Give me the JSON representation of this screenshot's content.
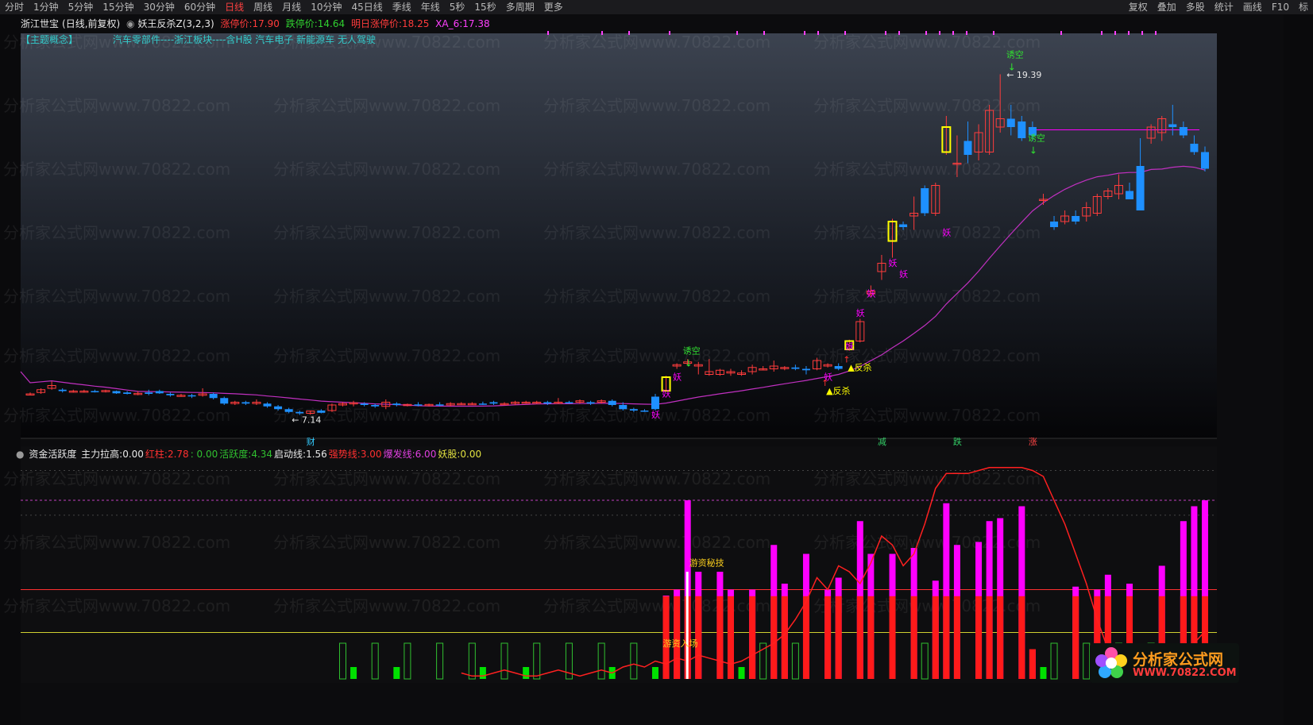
{
  "menu": {
    "items": [
      "分时",
      "1分钟",
      "5分钟",
      "15分钟",
      "30分钟",
      "60分钟",
      "日线",
      "周线",
      "月线",
      "10分钟",
      "45日线",
      "季线",
      "年线",
      "5秒",
      "15秒",
      "多周期",
      "更多"
    ],
    "active": "日线",
    "right_items": [
      "复权",
      "叠加",
      "多股",
      "统计",
      "画线",
      "F10",
      "标"
    ]
  },
  "stock": {
    "name": "浙江世宝",
    "mode": "(日线,前复权)",
    "indicator": "妖王反杀Z(3,2,3)",
    "limit_up_label": "涨停价:",
    "limit_up": "17.90",
    "limit_down_label": "跌停价:",
    "limit_down": "14.64",
    "next_up_label": "明日涨停价:",
    "next_up": "18.25",
    "xa_label": "XA_6:",
    "xa": "17.38"
  },
  "concepts": {
    "label": "【主题概念】",
    "text": "汽车零部件----浙江板块----含H股 汽车电子 新能源车 无人驾驶"
  },
  "watermark": "分析家公式网www.70822.com",
  "annotations": {
    "high": "19.39",
    "low": "7.14",
    "lure_short": "诱空",
    "demon": "妖",
    "counter_kill": "反杀",
    "hot_money_skill": "游资秘技",
    "hot_money_enter": "游资入场"
  },
  "event_marks": [
    {
      "text": "财",
      "color": "#3cf"
    },
    {
      "text": "减",
      "color": "#3c6"
    },
    {
      "text": "跌",
      "color": "#3c6"
    },
    {
      "text": "涨",
      "color": "#f44"
    }
  ],
  "indicator_panel": {
    "name": "资金活跃度",
    "fields": [
      {
        "label": "主力拉高:",
        "value": "0.00",
        "color": "#e8e8e8"
      },
      {
        "label": "红柱:",
        "value": "2.78",
        "color": "#ff3030"
      },
      {
        "label": ": ",
        "value": "0.00",
        "color": "#30c030"
      },
      {
        "label": "活跃度:",
        "value": "4.34",
        "color": "#30c030"
      },
      {
        "label": "启动线:",
        "value": "1.56",
        "color": "#e8e8e8"
      },
      {
        "label": "强势线:",
        "value": "3.00",
        "color": "#ff3030"
      },
      {
        "label": "爆发线:",
        "value": "6.00",
        "color": "#e040e0"
      },
      {
        "label": "妖股:",
        "value": "0.00",
        "color": "#e0e040"
      }
    ]
  },
  "logo": {
    "title": "分析家公式网",
    "url": "WWW.70822.COM"
  },
  "colors": {
    "up": "#ff3c3c",
    "down": "#1e90ff",
    "ma": "#c030c0",
    "magenta": "#ff00ff",
    "green": "#00e000",
    "yellow": "#ffff00",
    "cyan": "#66ffee",
    "bg_top": "#3c4350",
    "bg_bottom": "#050507"
  },
  "chart_data": {
    "type": "candlestick",
    "price_range": [
      6.5,
      20.5
    ],
    "high": 19.39,
    "low": 7.14,
    "candles_note": "approximate daily OHLC read from chart",
    "candles": [
      [
        7.9,
        7.95,
        7.85,
        7.9
      ],
      [
        7.95,
        8.1,
        7.9,
        8.05
      ],
      [
        8.1,
        8.35,
        8.05,
        8.2
      ],
      [
        8.05,
        8.1,
        7.95,
        8.0
      ],
      [
        8.0,
        8.05,
        7.95,
        8.0
      ],
      [
        8.0,
        8.05,
        7.95,
        8.0
      ],
      [
        8.0,
        8.05,
        7.95,
        7.98
      ],
      [
        7.98,
        8.05,
        7.95,
        8.02
      ],
      [
        8.0,
        8.02,
        7.9,
        7.92
      ],
      [
        7.95,
        8.0,
        7.88,
        7.9
      ],
      [
        7.9,
        8.0,
        7.85,
        7.92
      ],
      [
        7.95,
        8.05,
        7.85,
        7.9
      ],
      [
        8.0,
        8.05,
        7.9,
        7.92
      ],
      [
        7.9,
        7.95,
        7.8,
        7.85
      ],
      [
        7.85,
        7.9,
        7.8,
        7.85
      ],
      [
        7.85,
        7.9,
        7.75,
        7.82
      ],
      [
        7.85,
        8.1,
        7.8,
        7.9
      ],
      [
        7.9,
        7.95,
        7.7,
        7.75
      ],
      [
        7.75,
        7.8,
        7.5,
        7.55
      ],
      [
        7.55,
        7.65,
        7.5,
        7.6
      ],
      [
        7.6,
        7.65,
        7.5,
        7.55
      ],
      [
        7.55,
        7.7,
        7.5,
        7.6
      ],
      [
        7.55,
        7.6,
        7.4,
        7.45
      ],
      [
        7.45,
        7.5,
        7.3,
        7.35
      ],
      [
        7.35,
        7.4,
        7.2,
        7.25
      ],
      [
        7.25,
        7.3,
        7.14,
        7.2
      ],
      [
        7.2,
        7.3,
        7.15,
        7.28
      ],
      [
        7.3,
        7.35,
        7.2,
        7.22
      ],
      [
        7.3,
        7.55,
        7.25,
        7.5
      ],
      [
        7.5,
        7.6,
        7.45,
        7.55
      ],
      [
        7.55,
        7.65,
        7.45,
        7.58
      ],
      [
        7.55,
        7.6,
        7.45,
        7.5
      ],
      [
        7.5,
        7.55,
        7.4,
        7.45
      ],
      [
        7.45,
        7.7,
        7.35,
        7.6
      ],
      [
        7.55,
        7.6,
        7.45,
        7.5
      ],
      [
        7.5,
        7.55,
        7.45,
        7.52
      ],
      [
        7.52,
        7.6,
        7.45,
        7.5
      ],
      [
        7.5,
        7.55,
        7.45,
        7.52
      ],
      [
        7.52,
        7.6,
        7.45,
        7.5
      ],
      [
        7.5,
        7.6,
        7.45,
        7.55
      ],
      [
        7.55,
        7.6,
        7.5,
        7.55
      ],
      [
        7.55,
        7.6,
        7.5,
        7.55
      ],
      [
        7.55,
        7.62,
        7.5,
        7.52
      ],
      [
        7.6,
        7.65,
        7.5,
        7.55
      ],
      [
        7.55,
        7.6,
        7.5,
        7.55
      ],
      [
        7.55,
        7.65,
        7.5,
        7.6
      ],
      [
        7.6,
        7.65,
        7.55,
        7.6
      ],
      [
        7.6,
        7.65,
        7.55,
        7.6
      ],
      [
        7.6,
        7.65,
        7.5,
        7.55
      ],
      [
        7.6,
        7.75,
        7.55,
        7.6
      ],
      [
        7.6,
        7.65,
        7.55,
        7.58
      ],
      [
        7.6,
        7.7,
        7.55,
        7.65
      ],
      [
        7.6,
        7.65,
        7.5,
        7.55
      ],
      [
        7.6,
        7.7,
        7.55,
        7.65
      ],
      [
        7.65,
        7.7,
        7.45,
        7.5
      ],
      [
        7.5,
        7.6,
        7.3,
        7.35
      ],
      [
        7.35,
        7.4,
        7.25,
        7.3
      ],
      [
        7.3,
        7.35,
        7.25,
        7.28
      ],
      [
        7.8,
        7.9,
        7.3,
        7.35
      ],
      [
        8.01,
        8.55,
        8.0,
        8.5
      ],
      [
        8.9,
        9.0,
        8.8,
        8.95
      ],
      [
        9.0,
        9.15,
        8.95,
        9.05
      ],
      [
        8.9,
        9.05,
        8.6,
        8.95
      ],
      [
        8.6,
        9.15,
        8.55,
        8.7
      ],
      [
        8.6,
        8.8,
        8.55,
        8.75
      ],
      [
        8.65,
        8.8,
        8.55,
        8.7
      ],
      [
        8.6,
        8.75,
        8.55,
        8.65
      ],
      [
        8.7,
        8.95,
        8.6,
        8.85
      ],
      [
        8.8,
        8.9,
        8.75,
        8.8
      ],
      [
        8.8,
        9.1,
        8.7,
        8.9
      ],
      [
        8.85,
        8.9,
        8.75,
        8.85
      ],
      [
        8.85,
        8.95,
        8.75,
        8.8
      ],
      [
        8.8,
        8.9,
        8.6,
        8.75
      ],
      [
        8.8,
        9.2,
        8.75,
        9.1
      ],
      [
        8.9,
        9.0,
        8.85,
        8.95
      ],
      [
        8.9,
        9.0,
        8.75,
        8.8
      ],
      [
        9.5,
        9.85,
        9.45,
        9.8
      ],
      [
        9.8,
        10.6,
        9.75,
        10.5
      ],
      [
        11.5,
        11.8,
        11.4,
        11.6
      ],
      [
        12.3,
        12.9,
        12.0,
        12.6
      ],
      [
        13.4,
        14.2,
        12.8,
        14.1
      ],
      [
        14.0,
        14.1,
        13.8,
        13.9
      ],
      [
        14.3,
        15.0,
        13.8,
        14.4
      ],
      [
        15.3,
        15.4,
        14.3,
        14.4
      ],
      [
        14.4,
        15.5,
        14.3,
        15.4
      ],
      [
        16.6,
        17.9,
        16.5,
        17.5
      ],
      [
        16.2,
        17.2,
        15.7,
        16.2
      ],
      [
        17.0,
        17.7,
        16.2,
        16.5
      ],
      [
        16.6,
        17.6,
        16.3,
        17.3
      ],
      [
        16.6,
        18.3,
        16.5,
        18.1
      ],
      [
        17.5,
        19.4,
        17.3,
        17.8
      ],
      [
        17.8,
        18.3,
        17.2,
        17.5
      ],
      [
        17.7,
        17.9,
        17.0,
        17.1
      ],
      [
        17.5,
        17.7,
        17.0,
        17.2
      ],
      [
        14.9,
        15.1,
        14.7,
        14.9
      ],
      [
        14.1,
        14.3,
        13.8,
        13.9
      ],
      [
        14.1,
        14.5,
        14.0,
        14.3
      ],
      [
        14.3,
        14.5,
        14.0,
        14.1
      ],
      [
        14.3,
        14.8,
        14.1,
        14.6
      ],
      [
        14.4,
        15.1,
        14.3,
        15.0
      ],
      [
        15.0,
        15.3,
        14.9,
        15.2
      ],
      [
        15.1,
        15.8,
        14.9,
        15.4
      ],
      [
        15.2,
        15.5,
        14.9,
        14.9
      ],
      [
        16.1,
        17.1,
        14.5,
        14.5
      ],
      [
        17.1,
        17.6,
        16.9,
        17.5
      ],
      [
        17.3,
        17.9,
        17.0,
        17.8
      ],
      [
        17.6,
        18.3,
        17.2,
        17.5
      ],
      [
        17.5,
        17.7,
        17.1,
        17.2
      ],
      [
        16.9,
        17.2,
        16.5,
        16.6
      ],
      [
        16.6,
        16.8,
        15.9,
        16.0
      ]
    ],
    "ma_line_note": "purple trend line",
    "histogram": [
      0,
      0,
      0,
      0,
      0,
      0,
      0,
      0,
      0,
      0,
      0,
      0,
      0,
      0,
      0,
      0,
      0,
      0,
      0,
      0,
      0,
      0,
      0,
      0,
      0,
      0,
      0,
      0,
      0,
      0,
      2.8,
      3.0,
      6.0,
      3.6,
      0,
      3.6,
      3.0,
      0,
      3.0,
      0,
      4.5,
      3.2,
      0,
      4.2,
      0,
      3.0,
      3.4,
      0,
      5.3,
      4.2,
      0,
      4.2,
      0,
      4.4,
      0,
      3.3,
      5.9,
      4.5,
      0,
      4.6,
      5.3,
      5.4,
      0,
      5.8,
      1.0,
      0,
      0,
      0,
      3.1,
      0,
      3.0,
      3.5,
      0,
      3.2,
      0,
      0,
      3.8,
      0,
      5.3,
      5.8,
      6.0,
      6.0,
      6.0,
      3.7,
      3.7,
      0,
      4.5,
      3.9,
      3.5,
      5.2,
      4.3,
      4.7,
      4.2,
      0,
      0,
      0,
      0,
      0,
      0,
      0,
      0,
      5.6,
      0,
      4.0,
      3.8,
      0,
      4.6,
      2.7,
      2.8,
      0,
      0
    ],
    "activity_line_note": "red line rises from ~1.5 to ~6.9 then falls",
    "levels": {
      "start_line": 1.56,
      "strong_line": 3.0,
      "burst_line": 6.0
    }
  }
}
